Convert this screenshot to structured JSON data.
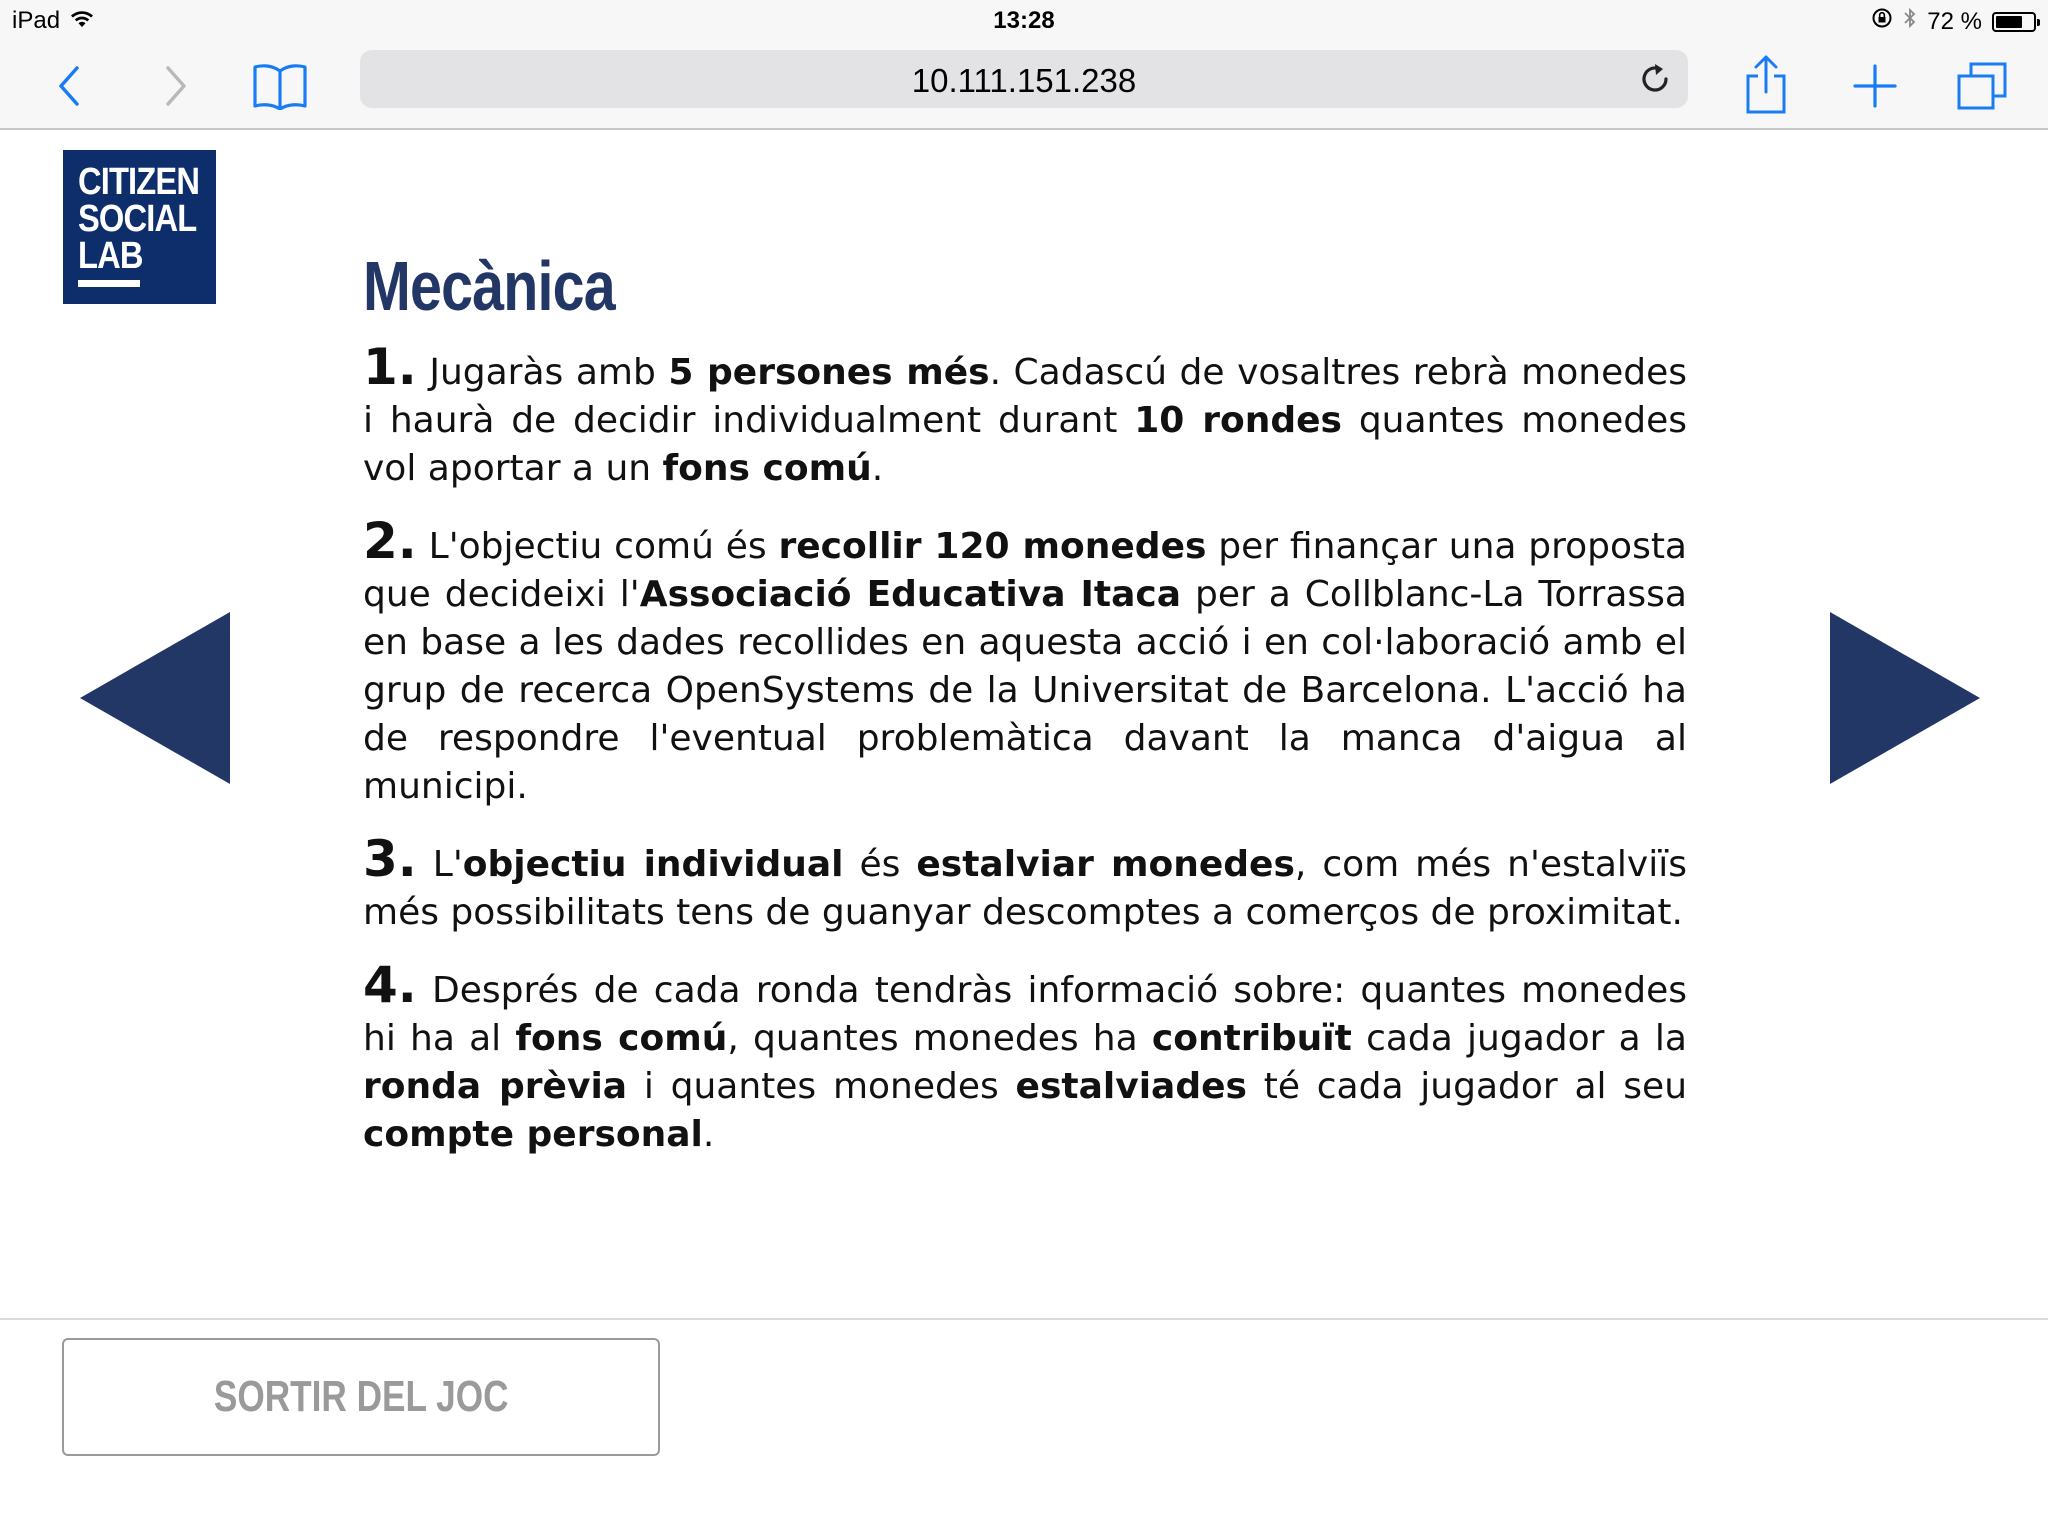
{
  "status_bar": {
    "device": "iPad",
    "time": "13:28",
    "battery_percent": "72 %",
    "battery_level": 0.72
  },
  "browser": {
    "url": "10.111.151.238",
    "icons": [
      "back-icon",
      "forward-icon",
      "bookmarks-icon",
      "reload-icon",
      "share-icon",
      "add-tab-icon",
      "tabs-icon"
    ]
  },
  "logo": {
    "line1": "CITIZEN",
    "line2": "SOCIAL",
    "line3": "LAB"
  },
  "page": {
    "title": "Mecànica",
    "items": [
      {
        "num": "1.",
        "segments": [
          {
            "t": " Jugaràs amb ",
            "b": false
          },
          {
            "t": "5 persones més",
            "b": true
          },
          {
            "t": ". Cadascú de vosaltres rebrà monedes i haurà de decidir individualment durant ",
            "b": false
          },
          {
            "t": "10 rondes",
            "b": true
          },
          {
            "t": " quantes monedes vol aportar a un ",
            "b": false
          },
          {
            "t": "fons comú",
            "b": true
          },
          {
            "t": ".",
            "b": false
          }
        ]
      },
      {
        "num": "2.",
        "segments": [
          {
            "t": " L'objectiu comú és ",
            "b": false
          },
          {
            "t": "recollir 120 monedes",
            "b": true
          },
          {
            "t": " per finançar una proposta que decideixi l'",
            "b": false
          },
          {
            "t": "Associació Educativa Itaca",
            "b": true
          },
          {
            "t": " per a Collblanc-La Torrassa en base a les dades recollides en aquesta acció i en col·laboració amb el grup de recerca OpenSystems de la Universitat de Barcelona. L'acció ha de respondre l'eventual problemàtica davant la manca d'aigua al municipi.",
            "b": false
          }
        ]
      },
      {
        "num": "3.",
        "segments": [
          {
            "t": " L'",
            "b": false
          },
          {
            "t": "objectiu individual",
            "b": true
          },
          {
            "t": " és ",
            "b": false
          },
          {
            "t": "estalviar monedes",
            "b": true
          },
          {
            "t": ", com més n'estalviïs més possibilitats tens de guanyar descomptes a comerços de proximitat.",
            "b": false
          }
        ]
      },
      {
        "num": "4.",
        "segments": [
          {
            "t": " Després de cada ronda tendràs informació sobre: quantes monedes hi ha al ",
            "b": false
          },
          {
            "t": "fons comú",
            "b": true
          },
          {
            "t": ", quantes monedes ha ",
            "b": false
          },
          {
            "t": "contribuït",
            "b": true
          },
          {
            "t": " cada jugador a la ",
            "b": false
          },
          {
            "t": "ronda prèvia",
            "b": true
          },
          {
            "t": " i quantes monedes ",
            "b": false
          },
          {
            "t": "estalviades",
            "b": true
          },
          {
            "t": " té cada jugador al seu ",
            "b": false
          },
          {
            "t": "compte personal",
            "b": true
          },
          {
            "t": ".",
            "b": false
          }
        ]
      }
    ]
  },
  "navigation": {
    "prev_icon": "arrow-left-icon",
    "next_icon": "arrow-right-icon"
  },
  "footer": {
    "exit_label": "SORTIR DEL JOC"
  },
  "colors": {
    "brand_navy": "#0e2d6b",
    "heading_navy": "#223766",
    "ios_blue": "#1a7cf5",
    "button_gray": "#9a9a9a"
  }
}
